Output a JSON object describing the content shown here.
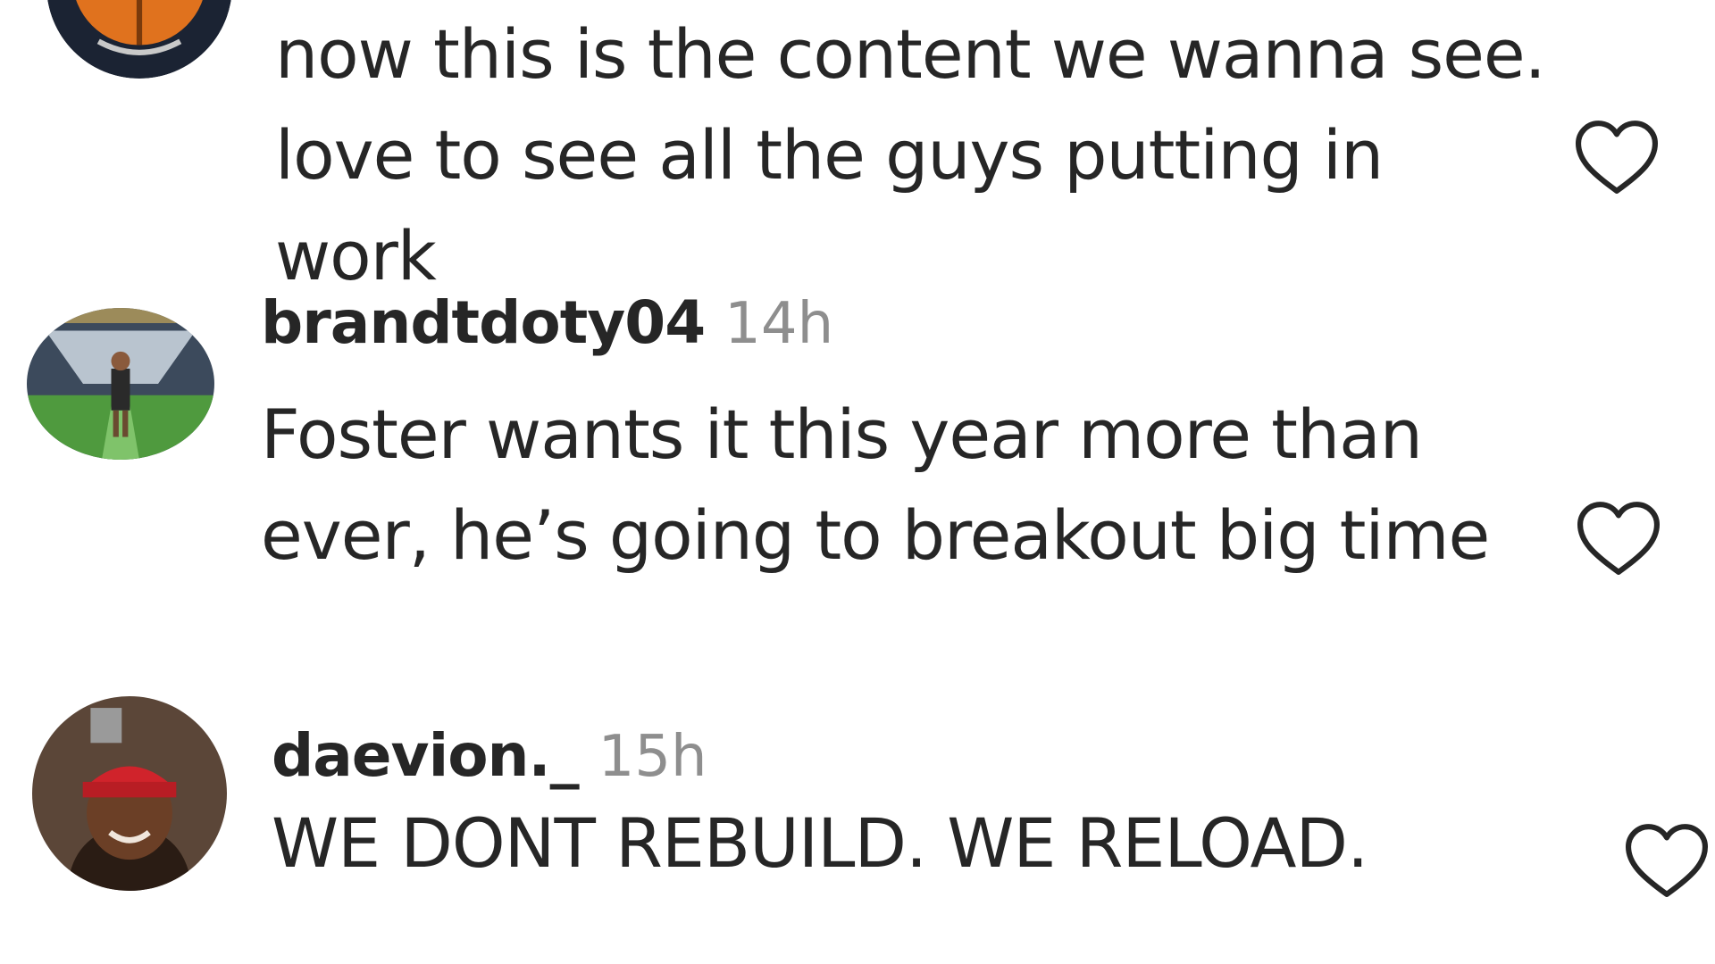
{
  "comments": [
    {
      "username": "",
      "time": "",
      "text": "now this is the content we wanna see. love to see all the guys putting in work",
      "avatar_icon": "orange-team-logo-avatar",
      "like_icon": "heart-outline-icon"
    },
    {
      "username": "brandtdoty04",
      "time": "14h",
      "text": "Foster wants it this year more than ever, he’s going to breakout big time",
      "avatar_icon": "stadium-photo-avatar",
      "like_icon": "heart-outline-icon"
    },
    {
      "username": "daevion._",
      "time": "15h",
      "text": "WE DONT REBUILD. WE RELOAD.",
      "avatar_icon": "red-cap-selfie-avatar",
      "like_icon": "heart-outline-icon"
    }
  ],
  "colors": {
    "text": "#262626",
    "muted": "#8e8e8e",
    "heart_stroke": "#262626"
  }
}
